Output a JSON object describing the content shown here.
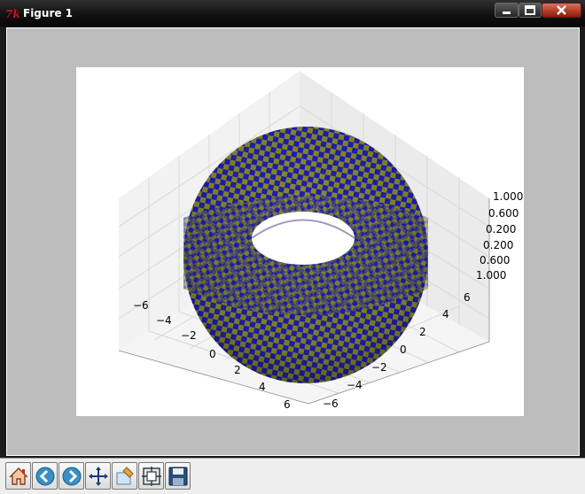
{
  "window": {
    "title": "Figure 1",
    "app_icon": "tk-feather-icon",
    "controls": [
      "minimize-icon",
      "maximize-icon",
      "close-icon"
    ]
  },
  "plot": {
    "type": "3d-surface-torus",
    "colors": {
      "checker_a": "#1f1fb4",
      "checker_b": "#8a8a2a"
    },
    "x_ticks": [
      "−6",
      "−4",
      "−2",
      "0",
      "2",
      "4",
      "6"
    ],
    "y_ticks": [
      "−6",
      "−4",
      "−2",
      "0",
      "2",
      "4",
      "6"
    ],
    "z_ticks": [
      "1.000",
      "0.600",
      "0.200",
      "0.200",
      "0.600",
      "1.000"
    ]
  },
  "toolbar": {
    "buttons": [
      {
        "name": "home-button",
        "icon": "home-icon"
      },
      {
        "name": "back-button",
        "icon": "back-arrow-icon"
      },
      {
        "name": "forward-button",
        "icon": "forward-arrow-icon"
      },
      {
        "name": "pan-button",
        "icon": "move-arrows-icon"
      },
      {
        "name": "zoom-button",
        "icon": "zoom-rect-icon"
      },
      {
        "name": "subplots-button",
        "icon": "configure-subplots-icon"
      },
      {
        "name": "save-button",
        "icon": "floppy-disk-icon"
      }
    ]
  }
}
